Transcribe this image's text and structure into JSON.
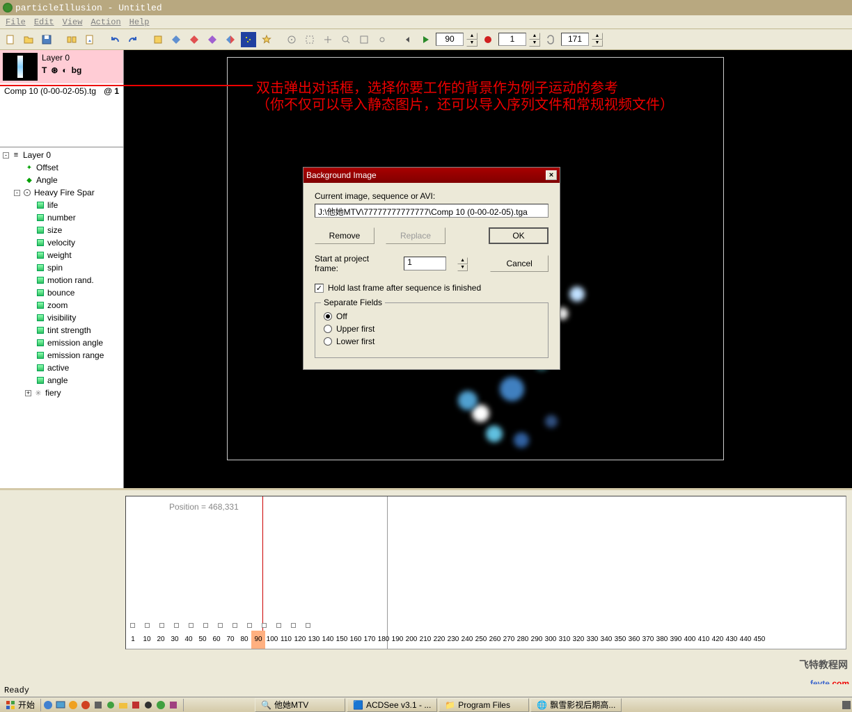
{
  "title": "particleIllusion - Untitled",
  "menu": [
    "File",
    "Edit",
    "View",
    "Action",
    "Help"
  ],
  "toolbar": {
    "frame_current": "90",
    "frame_start": "1",
    "frame_end": "171"
  },
  "layer_panel": {
    "name": "Layer 0",
    "labels": [
      "T",
      "⊛",
      "◐",
      "bg"
    ],
    "comp": "Comp 10 (0-00-02-05).tg",
    "comp_at": "@ 1"
  },
  "tree": {
    "root": "Layer 0",
    "offset": "Offset",
    "angle": "Angle",
    "emitter": "Heavy Fire Spar",
    "items": [
      "life",
      "number",
      "size",
      "velocity",
      "weight",
      "spin",
      "motion rand.",
      "bounce",
      "zoom",
      "visibility",
      "tint strength",
      "emission angle",
      "emission range",
      "active",
      "angle"
    ],
    "fiery": "fiery"
  },
  "annot": {
    "line1": "双击弹出对话框，选择你要工作的背景作为例子运动的参考",
    "line2": "（你不仅可以导入静态图片，还可以导入序列文件和常规视频文件）"
  },
  "dialog": {
    "title": "Background Image",
    "label_current": "Current image, sequence or AVI:",
    "path": "J:\\他她MTV\\77777777777777\\Comp 10 (0-00-02-05).tga",
    "btn_remove": "Remove",
    "btn_replace": "Replace",
    "btn_ok": "OK",
    "btn_cancel": "Cancel",
    "label_start": "Start at project frame:",
    "start_value": "1",
    "hold_label": "Hold last frame after sequence is finished",
    "group": "Separate Fields",
    "rad_off": "Off",
    "rad_upper": "Upper first",
    "rad_lower": "Lower first"
  },
  "timeline": {
    "position": "Position = 468,331",
    "ruler": [
      "1",
      "10",
      "20",
      "30",
      "40",
      "50",
      "60",
      "70",
      "80",
      "90",
      "100",
      "110",
      "120",
      "130",
      "140",
      "150",
      "160",
      "170",
      "180",
      "190",
      "200",
      "210",
      "220",
      "230",
      "240",
      "250",
      "260",
      "270",
      "280",
      "290",
      "300",
      "310",
      "320",
      "330",
      "340",
      "350",
      "360",
      "370",
      "380",
      "390",
      "400",
      "410",
      "420",
      "430",
      "440",
      "450"
    ],
    "current_frame": "90"
  },
  "status": "Ready",
  "taskbar": {
    "start": "开始",
    "items": [
      "他她MTV",
      "ACDSee v3.1 - ...",
      "Program Files",
      "飘雪影视后期高..."
    ]
  },
  "logo": {
    "main": "fevte",
    "dot": ".com",
    "sub": "飞特教程网"
  }
}
